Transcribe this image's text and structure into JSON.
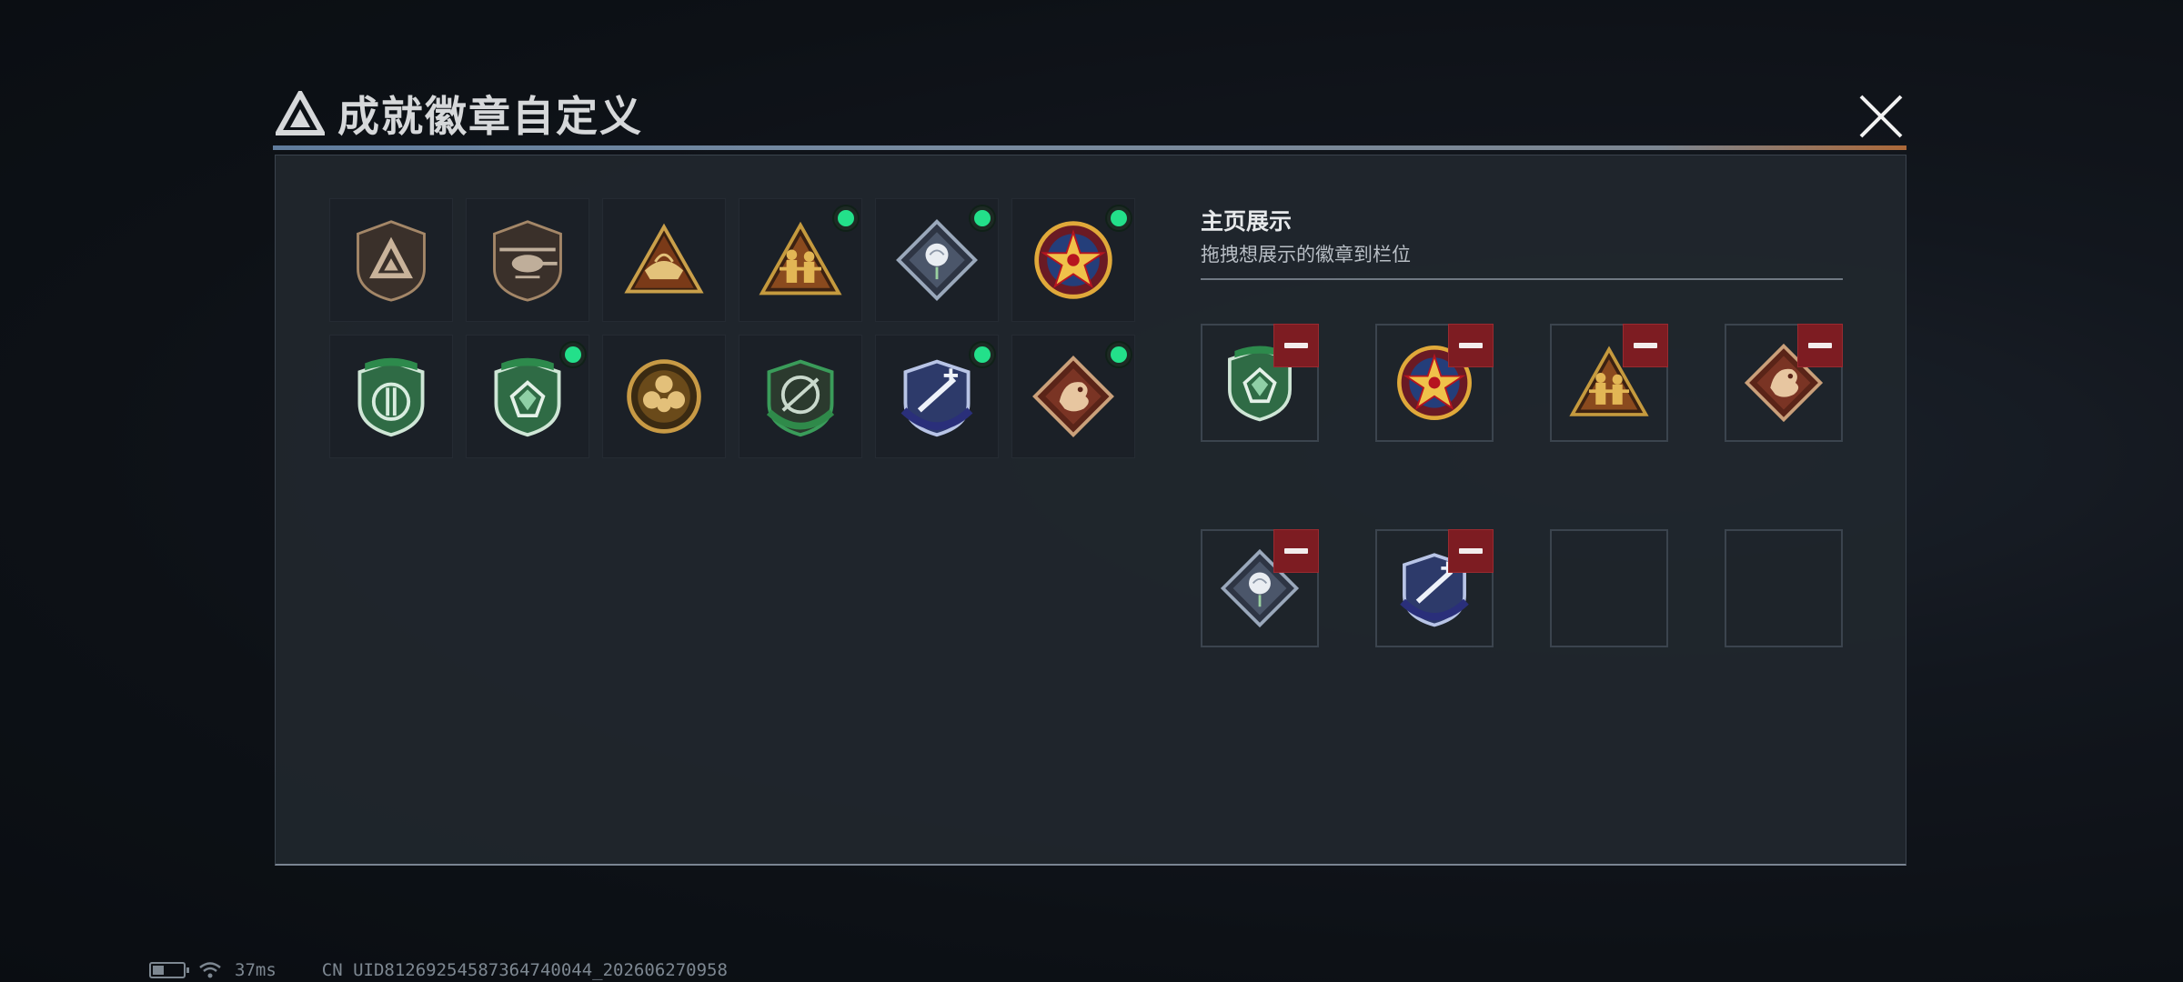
{
  "window": {
    "title": "成就徽章自定义",
    "close_label": "close"
  },
  "badges": [
    {
      "name": "delta-shield",
      "equipped": false
    },
    {
      "name": "helicopter-shield",
      "equipped": false
    },
    {
      "name": "ship-triangle",
      "equipped": false
    },
    {
      "name": "soldiers-triangle",
      "equipped": true
    },
    {
      "name": "rose-diamond",
      "equipped": true
    },
    {
      "name": "star-emblem",
      "equipped": true
    },
    {
      "name": "green-shield-sword",
      "equipped": false
    },
    {
      "name": "green-shield-gem",
      "equipped": true
    },
    {
      "name": "gold-medallion",
      "equipped": false
    },
    {
      "name": "green-target-shield",
      "equipped": false
    },
    {
      "name": "blue-blade-shield",
      "equipped": true
    },
    {
      "name": "dragon-diamond",
      "equipped": true
    }
  ],
  "showcase": {
    "title": "主页展示",
    "subtitle": "拖拽想展示的徽章到栏位",
    "slots": [
      {
        "badge": "green-shield-gem",
        "filled": true
      },
      {
        "badge": "star-emblem",
        "filled": true
      },
      {
        "badge": "soldiers-triangle",
        "filled": true
      },
      {
        "badge": "dragon-diamond",
        "filled": true
      },
      {
        "badge": "rose-diamond",
        "filled": true
      },
      {
        "badge": "blue-blade-shield",
        "filled": true
      },
      {
        "badge": "",
        "filled": false
      },
      {
        "badge": "",
        "filled": false
      }
    ]
  },
  "status_bar": {
    "ping": "37ms",
    "uid": "CN UID81269254587364740044_202606270958"
  },
  "colors": {
    "equipped_dot": "#23e08a",
    "remove_button": "#7d1c22",
    "accent_line": "#6e8fb5"
  }
}
